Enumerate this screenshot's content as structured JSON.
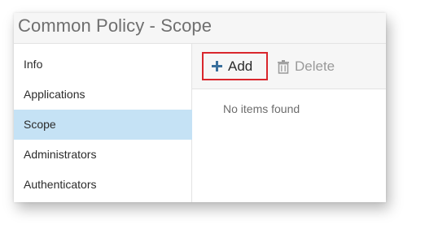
{
  "window": {
    "title": "Common Policy - Scope"
  },
  "sidebar": {
    "items": [
      {
        "label": "Info",
        "active": false
      },
      {
        "label": "Applications",
        "active": false
      },
      {
        "label": "Scope",
        "active": true
      },
      {
        "label": "Administrators",
        "active": false
      },
      {
        "label": "Authenticators",
        "active": false
      }
    ]
  },
  "toolbar": {
    "add_label": "Add",
    "add_icon": "plus-icon",
    "delete_label": "Delete",
    "delete_icon": "trash-icon",
    "highlight_color": "#d9262c"
  },
  "content": {
    "empty_message": "No items found"
  },
  "colors": {
    "active_item_bg": "#c5e2f5",
    "accent": "#3a6f9c"
  }
}
